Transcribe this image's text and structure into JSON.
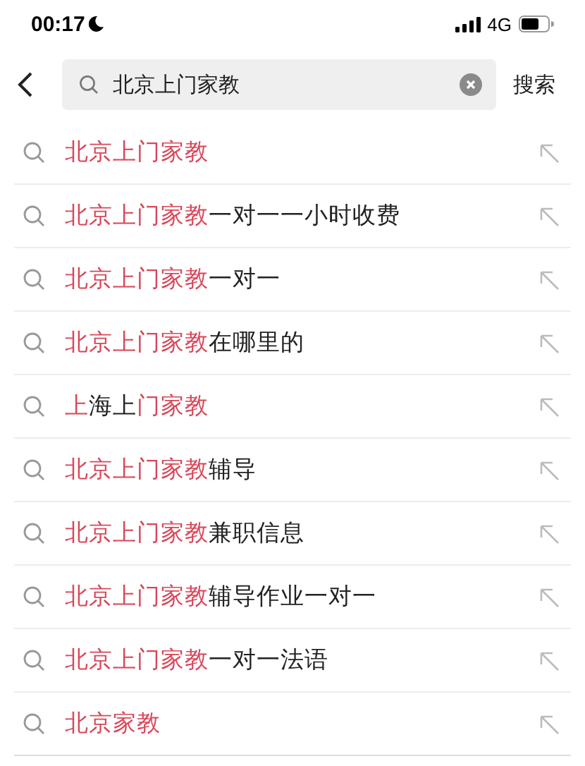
{
  "status_bar": {
    "time": "00:17",
    "network": "4G"
  },
  "search": {
    "value": "北京上门家教",
    "action": "搜索"
  },
  "suggestions": [
    {
      "parts": [
        {
          "text": "北京上门家教",
          "match": true
        }
      ]
    },
    {
      "parts": [
        {
          "text": "北京上门家教",
          "match": true
        },
        {
          "text": "一对一一小时收费",
          "match": false
        }
      ]
    },
    {
      "parts": [
        {
          "text": "北京上门家教",
          "match": true
        },
        {
          "text": "一对一",
          "match": false
        }
      ]
    },
    {
      "parts": [
        {
          "text": "北京上门家教",
          "match": true
        },
        {
          "text": "在哪里的",
          "match": false
        }
      ]
    },
    {
      "parts": [
        {
          "text": "上",
          "match": true
        },
        {
          "text": "海上",
          "match": false
        },
        {
          "text": "门家教",
          "match": true
        }
      ]
    },
    {
      "parts": [
        {
          "text": "北京上门家教",
          "match": true
        },
        {
          "text": "辅导",
          "match": false
        }
      ]
    },
    {
      "parts": [
        {
          "text": "北京上门家教",
          "match": true
        },
        {
          "text": "兼职信息",
          "match": false
        }
      ]
    },
    {
      "parts": [
        {
          "text": "北京上门家教",
          "match": true
        },
        {
          "text": "辅导作业一对一",
          "match": false
        }
      ]
    },
    {
      "parts": [
        {
          "text": "北京上门家教",
          "match": true
        },
        {
          "text": "一对一法语",
          "match": false
        }
      ]
    },
    {
      "parts": [
        {
          "text": "北京家教",
          "match": true
        }
      ]
    }
  ]
}
